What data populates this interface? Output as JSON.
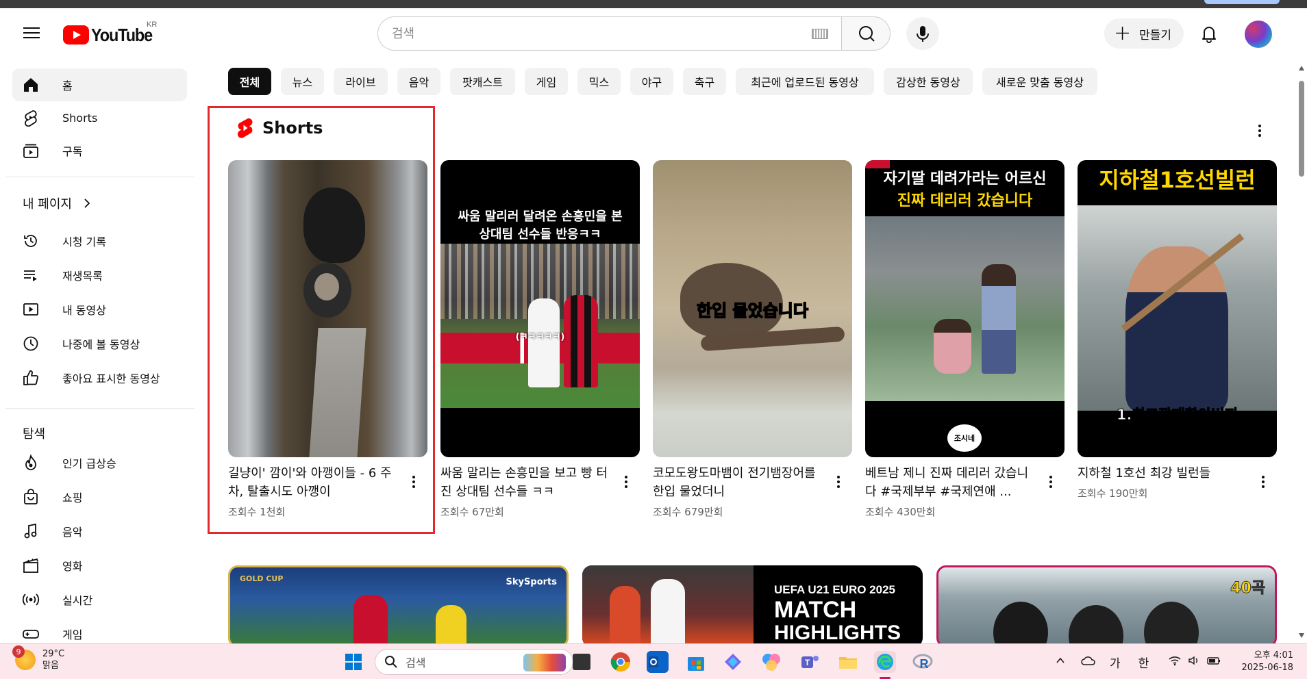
{
  "masthead": {
    "logo_text": "YouTube",
    "country_code": "KR",
    "search_placeholder": "검색",
    "create_label": "만들기"
  },
  "sidebar": {
    "main_items": [
      {
        "label": "홈",
        "icon": "home-icon",
        "active": true
      },
      {
        "label": "Shorts",
        "icon": "shorts-icon"
      },
      {
        "label": "구독",
        "icon": "subscriptions-icon"
      }
    ],
    "you_section_title": "내 페이지",
    "you_items": [
      {
        "label": "시청 기록",
        "icon": "history-icon"
      },
      {
        "label": "재생목록",
        "icon": "playlists-icon"
      },
      {
        "label": "내 동영상",
        "icon": "your-videos-icon"
      },
      {
        "label": "나중에 볼 동영상",
        "icon": "watch-later-icon"
      },
      {
        "label": "좋아요 표시한 동영상",
        "icon": "liked-videos-icon"
      }
    ],
    "explore_title": "탐색",
    "explore_items": [
      {
        "label": "인기 급상승",
        "icon": "trending-icon"
      },
      {
        "label": "쇼핑",
        "icon": "shopping-icon"
      },
      {
        "label": "음악",
        "icon": "music-icon"
      },
      {
        "label": "영화",
        "icon": "movies-icon"
      },
      {
        "label": "실시간",
        "icon": "live-icon"
      },
      {
        "label": "게임",
        "icon": "gaming-icon"
      }
    ]
  },
  "chips": [
    "전체",
    "뉴스",
    "라이브",
    "음악",
    "팟캐스트",
    "게임",
    "믹스",
    "야구",
    "축구",
    "최근에 업로드된 동영상",
    "감상한 동영상",
    "새로운 맞춤 동영상"
  ],
  "shorts": {
    "title": "Shorts",
    "items": [
      {
        "title": "길냥이' 깜이'와 아깽이들 - 6 주차, 탈출시도 아깽이",
        "views": "조회수 1천회",
        "thumb_caption": ""
      },
      {
        "title": "싸움 말리는 손흥민을 보고 빵 터진 상대팀 선수들 ㅋㅋ",
        "views": "조회수 67만회",
        "thumb_caption_1": "싸움 말리러 달려온 손흥민을 본",
        "thumb_caption_2": "상대팀 선수들 반응ㅋㅋ",
        "thumb_subtitle": "(ㅋㅋㅋㅋㅋ)"
      },
      {
        "title": "코모도왕도마뱀이 전기뱀장어를 한입 물었더니",
        "views": "조회수 679만회",
        "thumb_caption": "한입 물었습니다"
      },
      {
        "title": "베트남 제니 진짜 데리러 갔습니다 #국제부부 #국제연애 ...",
        "views": "조회수 430만회",
        "thumb_caption_1": "자기딸 데려가라는 어르신",
        "thumb_caption_2": "진짜 데리러 갔습니다",
        "thumb_badge": "조시네"
      },
      {
        "title": "지하철 1호선 최강 빌런들",
        "views": "조회수 190만회",
        "thumb_caption_1": "지하철1호선빌런",
        "thumb_caption_2": "1.최고깡패할아버지"
      }
    ]
  },
  "videos": [
    {
      "thumb_badge_1": "GOLD CUP",
      "thumb_badge_2": "SkySports"
    },
    {
      "thumb_line_1": "UEFA U21 EURO 2025",
      "thumb_line_2": "MATCH",
      "thumb_line_3": "HIGHLIGHTS"
    },
    {
      "thumb_badge": "40곡"
    }
  ],
  "taskbar": {
    "weather_badge": "9",
    "temperature": "29°C",
    "condition": "맑음",
    "search_label": "검색",
    "ime_1": "가",
    "ime_2": "한",
    "time": "오후 4:01",
    "date": "2025-06-18"
  },
  "colors": {
    "brand_red": "#ff0000",
    "highlight_border": "#e22a2a",
    "chip_active": "#0f0f0f",
    "taskbar_bg": "#fce8ec"
  }
}
